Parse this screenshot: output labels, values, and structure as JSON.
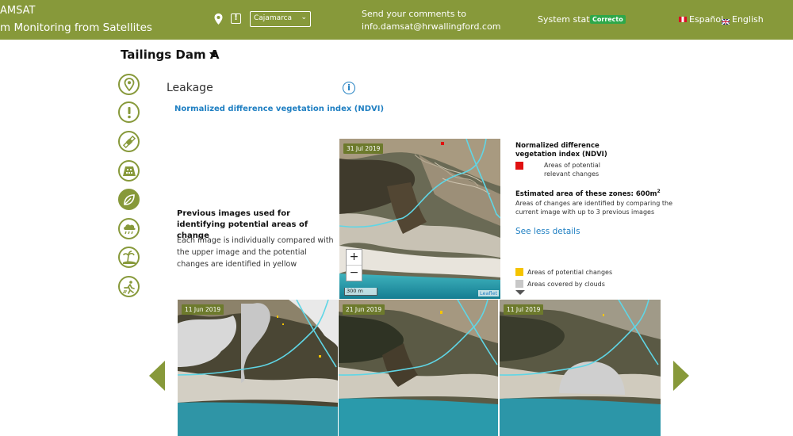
{
  "header": {
    "brand_line1": "AMSAT",
    "brand_line2": "m Monitoring from Satellites",
    "location_select": "Cajamarca",
    "comments_line1": "Send your comments to",
    "comments_email": "info.damsat@hrwallingford.com",
    "system_status_label": "System status",
    "system_status_badge": "Correcto",
    "lang_es": "Español",
    "lang_en": "English",
    "warn_glyph": "!"
  },
  "dam": {
    "title": "Tailings Dam A"
  },
  "sidebar": {
    "items": [
      {
        "icon": "location-pin-icon"
      },
      {
        "icon": "alert-icon"
      },
      {
        "icon": "satellite-icon"
      },
      {
        "icon": "dam-icon"
      },
      {
        "icon": "leaf-icon",
        "active": true
      },
      {
        "icon": "weather-icon"
      },
      {
        "icon": "island-icon"
      },
      {
        "icon": "runner-icon"
      }
    ]
  },
  "section": {
    "title": "Leakage",
    "info_glyph": "i",
    "ndvi_link": "Normalized difference vegetation index (NDVI)",
    "previous_title": "Previous images used for identifying potential areas of change",
    "previous_desc": "Each image is individually compared with the upper image and the potential changes are identified in yellow"
  },
  "main_map": {
    "date": "31 Jul 2019",
    "zoom_in": "+",
    "zoom_out": "−",
    "scale": "300 m",
    "attribution": "Leaflet"
  },
  "legend": {
    "title": "Normalized difference vegetation index (NDVI)",
    "red_label": "Areas of potential relevant changes",
    "estimated_label": "Estimated area of these zones: 600m²",
    "estimated_desc": "Areas of changes are identified by comparing the current image with up to 3 previous images",
    "see_less": "See less details",
    "yellow_label": "Areas of potential changes",
    "gray_label": "Areas covered by clouds",
    "colors": {
      "red": "#e01010",
      "yellow": "#f5c400",
      "gray": "#c8c8c8"
    }
  },
  "previous_images": [
    {
      "date": "11 Jun 2019"
    },
    {
      "date": "21 Jun 2019"
    },
    {
      "date": "11 Jul 2019"
    }
  ],
  "colors": {
    "brand": "#87993a",
    "link": "#1f7fc2",
    "status_ok": "#2ea84a",
    "boundary": "#5fd6e6"
  }
}
